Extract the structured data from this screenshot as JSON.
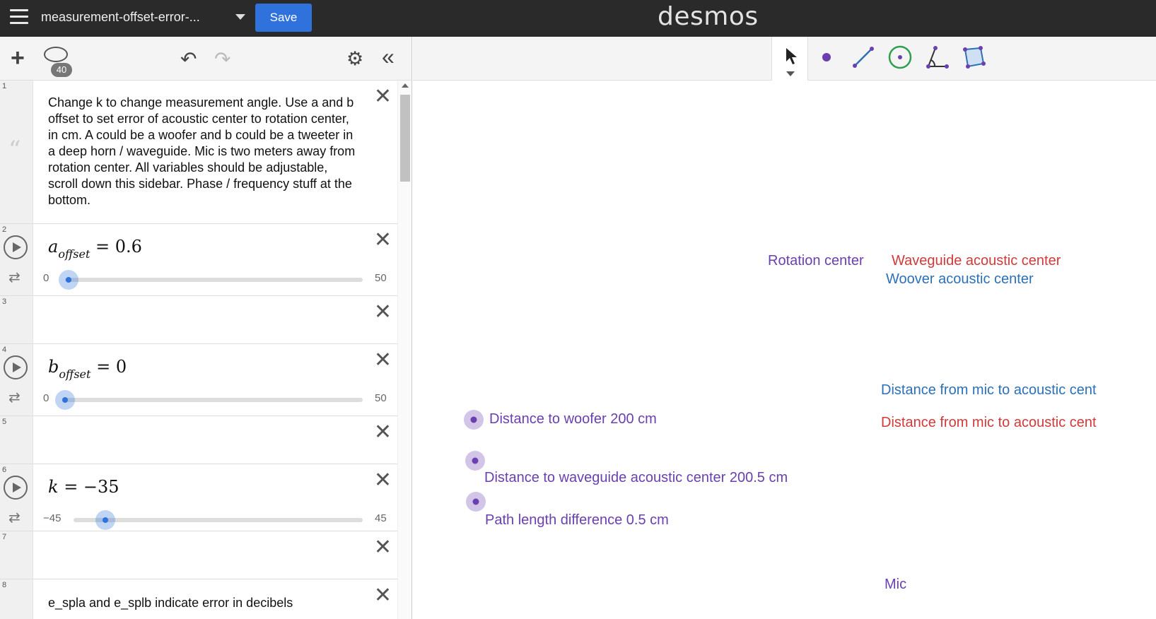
{
  "header": {
    "title": "measurement-offset-error-...",
    "save_label": "Save",
    "brand": "desmos"
  },
  "sidebar_toolbar": {
    "badge_count": "40"
  },
  "expressions": [
    {
      "index": "1",
      "type": "note",
      "text": "Change k to change measurement angle. Use a and b offset to set error of acoustic center to rotation center, in cm. A could be a woofer and b could be a tweeter in a deep horn / waveguide. Mic is two meters away from rotation center. All variables should be adjustable, scroll down this sidebar. Phase / frequency stuff at the bottom."
    },
    {
      "index": "2",
      "type": "slider",
      "var": "a",
      "sub": "offset",
      "eq": "= 0.6",
      "min": "0",
      "max": "50",
      "value": 0.6,
      "range": [
        0,
        50
      ]
    },
    {
      "index": "3",
      "type": "empty"
    },
    {
      "index": "4",
      "type": "slider",
      "var": "b",
      "sub": "offset",
      "eq": "= 0",
      "min": "0",
      "max": "50",
      "value": 0,
      "range": [
        0,
        50
      ]
    },
    {
      "index": "5",
      "type": "empty"
    },
    {
      "index": "6",
      "type": "slider",
      "var": "k",
      "sub": "",
      "eq": "= −35",
      "min": "−45",
      "max": "45",
      "value": -35,
      "range": [
        -45,
        45
      ]
    },
    {
      "index": "7",
      "type": "empty"
    },
    {
      "index": "8",
      "type": "note",
      "text": "e_spla and e_splb indicate error in decibels"
    }
  ],
  "graph": {
    "labels": {
      "rotation_center": "Rotation center",
      "waveguide_center": "Waveguide acoustic center",
      "woofer_center": "Woover acoustic center",
      "dist_mic_blue": "Distance from mic to acoustic cent",
      "dist_mic_red": "Distance from mic to acoustic cent",
      "dist_woofer": "Distance to woofer 200 cm",
      "dist_waveguide": "Distance to waveguide acoustic center 200.5 cm",
      "path_diff": "Path length difference 0.5 cm",
      "mic": "Mic"
    },
    "colors": {
      "purple": "#6a3fb0",
      "red": "#d03a3a",
      "blue": "#2c70b8",
      "orange": "#f07f1a"
    }
  },
  "icons": {
    "menu": "hamburger-icon",
    "title_dropdown": "caret-down-icon",
    "add": "plus-icon",
    "ellipse": "ellipse-icon",
    "undo": "undo-icon",
    "redo": "redo-icon",
    "settings": "gear-icon",
    "collapse": "double-chevron-left-icon"
  }
}
